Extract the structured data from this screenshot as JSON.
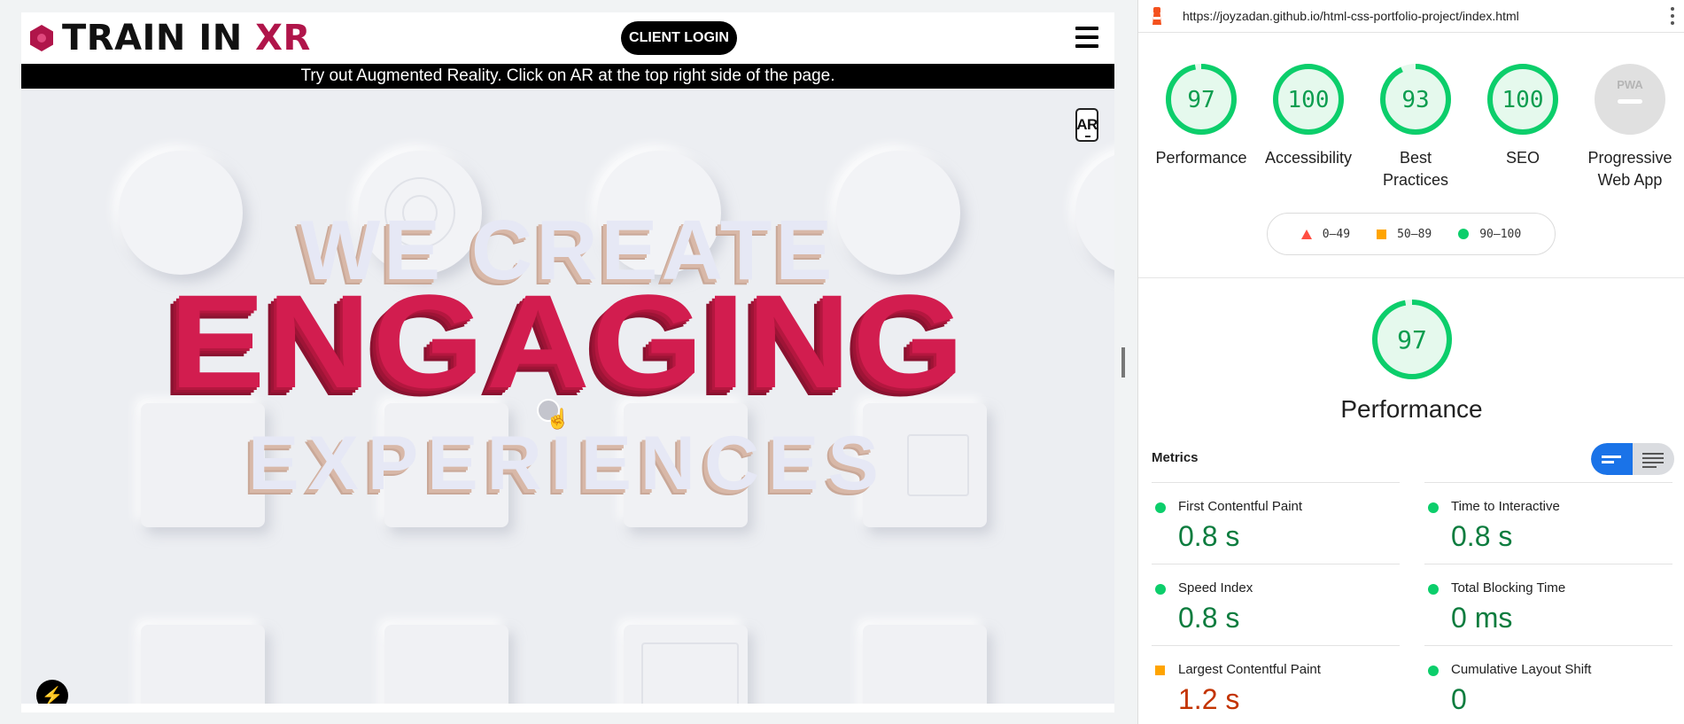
{
  "site": {
    "logo_main": "TRAIN IN ",
    "logo_accent": "XR",
    "client_login_label": "CLIENT LOGIN",
    "banner_text": "Try out Augmented Reality. Click on AR at the top right side of the page.",
    "ar_label": "AR",
    "hero_line1": "WE CREATE",
    "hero_line2": "ENGAGING",
    "hero_line3": "EXPERIENCES",
    "bottom_icon_glyph": "⚡"
  },
  "lighthouse": {
    "url": "https://joyzadan.github.io/html-css-portfolio-project/index.html",
    "gauges": [
      {
        "label": "Performance",
        "score": "97",
        "value": 97
      },
      {
        "label": "Accessibility",
        "score": "100",
        "value": 100
      },
      {
        "label": "Best Practices",
        "score": "93",
        "value": 93
      },
      {
        "label": "SEO",
        "score": "100",
        "value": 100
      },
      {
        "label": "Progressive Web App",
        "score": "PWA",
        "value": 0
      }
    ],
    "legend": {
      "fail": "0–49",
      "average": "50–89",
      "pass": "90–100"
    },
    "main_score": "97",
    "main_title": "Performance",
    "metrics_title": "Metrics",
    "metrics": [
      {
        "name": "First Contentful Paint",
        "value": "0.8 s",
        "status": "pass"
      },
      {
        "name": "Time to Interactive",
        "value": "0.8 s",
        "status": "pass"
      },
      {
        "name": "Speed Index",
        "value": "0.8 s",
        "status": "pass"
      },
      {
        "name": "Total Blocking Time",
        "value": "0 ms",
        "status": "pass"
      },
      {
        "name": "Largest Contentful Paint",
        "value": "1.2 s",
        "status": "average"
      },
      {
        "name": "Cumulative Layout Shift",
        "value": "0",
        "status": "pass"
      }
    ],
    "colors": {
      "pass": "#0cce6b",
      "average": "#ffa400",
      "fail": "#ff4e42",
      "pass_text": "#0c7c3e",
      "average_text": "#c33300"
    }
  }
}
